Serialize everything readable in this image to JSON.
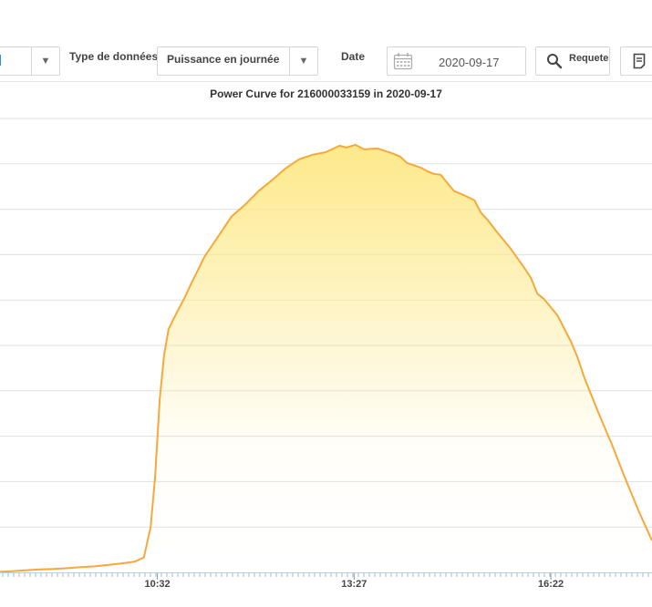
{
  "toolbar": {
    "data_type_label": "Type de données",
    "data_type_value": "Puissance en journée",
    "date_label": "Date",
    "date_value": "2020-09-17",
    "query_label": "Requete"
  },
  "colors": {
    "line": "#f5a93b",
    "fill_top": "#fde98a",
    "accent": "#2f8fd8"
  },
  "chart_data": {
    "type": "area",
    "title": "Power Curve for 216000033159 in 2020-09-17",
    "xlabel": "",
    "ylabel": "",
    "xlim": [
      "08:12",
      "17:52"
    ],
    "x_ticks": [
      "10:32",
      "13:27",
      "16:22"
    ],
    "grid": true,
    "series": [
      {
        "x": [
          "08:12",
          "08:24",
          "08:36",
          "08:48",
          "09:00",
          "09:12",
          "09:24",
          "09:36",
          "09:48",
          "10:00",
          "10:12",
          "10:20",
          "10:26",
          "10:30",
          "10:34",
          "10:38",
          "10:42",
          "10:46",
          "10:50",
          "10:56",
          "11:02",
          "11:14",
          "11:26",
          "11:38",
          "11:50",
          "12:02",
          "12:14",
          "12:26",
          "12:38",
          "12:50",
          "13:02",
          "13:14",
          "13:20",
          "13:28",
          "13:36",
          "13:48",
          "14:00",
          "14:08",
          "14:14",
          "14:26",
          "14:32",
          "14:38",
          "14:44",
          "14:56",
          "15:02",
          "15:14",
          "15:20",
          "15:26",
          "15:34",
          "15:46",
          "15:58",
          "16:04",
          "16:10",
          "16:16",
          "16:28",
          "16:40",
          "16:46",
          "16:52",
          "17:04",
          "17:16",
          "17:28",
          "17:40",
          "17:52"
        ],
        "values": [
          0.6,
          1.4,
          2.4,
          3.2,
          3.7,
          4.6,
          5.7,
          6.6,
          8.1,
          9.8,
          11.8,
          16.5,
          50,
          105,
          190,
          240,
          268,
          278,
          288,
          302,
          318,
          348,
          370,
          392,
          405,
          420,
          432,
          445,
          455,
          460,
          463,
          470,
          468,
          471,
          466,
          467,
          462,
          458,
          451,
          446,
          442,
          439,
          438,
          420,
          417,
          410,
          396,
          388,
          375,
          357,
          336,
          325,
          307,
          301,
          283,
          254,
          236,
          214,
          177,
          142,
          104,
          68,
          35
        ]
      }
    ]
  }
}
